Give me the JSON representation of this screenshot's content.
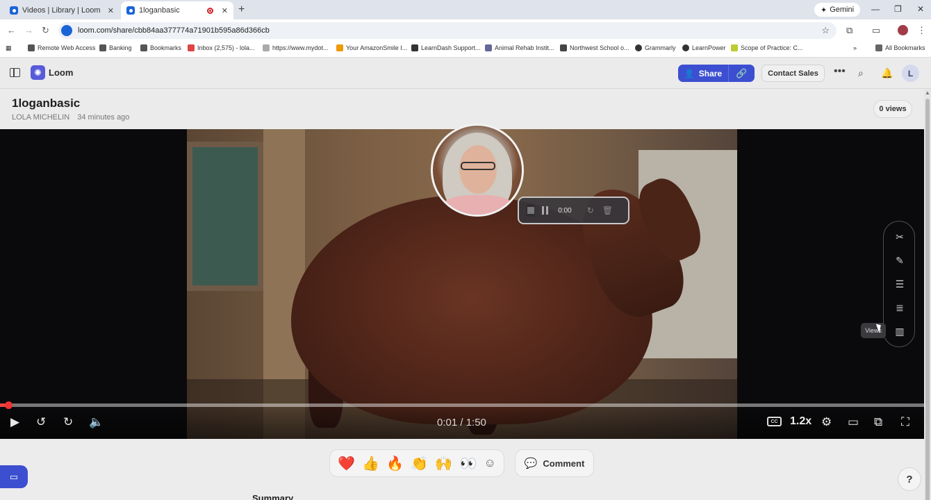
{
  "browser": {
    "tabs": [
      {
        "title": "Videos | Library | Loom",
        "close": "✕"
      },
      {
        "title": "1loganbasic",
        "close": "✕"
      }
    ],
    "new_tab": "+",
    "gemini": "Gemini",
    "url": "loom.com/share/cbb84aa377774a71901b595a86d366cb",
    "bookmarks": [
      "Remote Web Access",
      "Banking",
      "Bookmarks",
      "Inbox (2,575) - lola...",
      "https://www.mydot...",
      "Your AmazonSmile I...",
      "LearnDash Support...",
      "Animal Rehab Instit...",
      "Northwest School o...",
      "Grammarly",
      "LearnPower",
      "Scope of Practice: C..."
    ],
    "all_bookmarks": "All Bookmarks"
  },
  "header": {
    "brand": "Loom",
    "share_label": "Share",
    "contact_label": "Contact Sales",
    "avatar_letter": "L"
  },
  "video": {
    "title": "1loganbasic",
    "author": "LOLA MICHELIN",
    "posted": "34 minutes ago",
    "views": "0 views",
    "recording_time": "0:00",
    "timecode": "0:01 / 1:50",
    "speed": "1.2x",
    "cc": "CC",
    "progress": 0.009,
    "tooltip": "Views"
  },
  "reactions": [
    "❤️",
    "👍",
    "🔥",
    "👏",
    "🙌",
    "👀"
  ],
  "comment_label": "Comment",
  "help_label": "?",
  "summary_label": "Summary",
  "colors": {
    "brand_blue": "#3c4fd1",
    "loom_logo": "#565adb",
    "progress_red": "#e44444"
  }
}
